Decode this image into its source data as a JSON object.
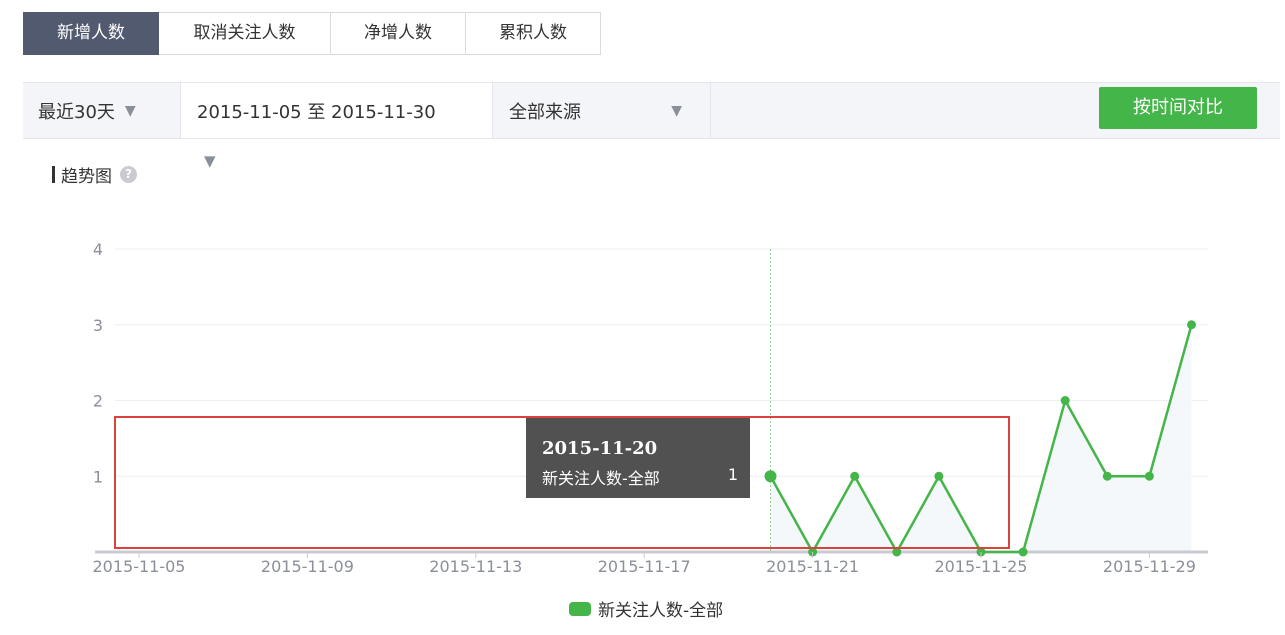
{
  "tabs": [
    {
      "label": "新增人数",
      "active": true
    },
    {
      "label": "取消关注人数",
      "active": false
    },
    {
      "label": "净增人数",
      "active": false
    },
    {
      "label": "累积人数",
      "active": false
    }
  ],
  "filters": {
    "range": "最近30天",
    "dates": "2015-11-05 至 2015-11-30",
    "source": "全部来源",
    "compare_button": "按时间对比"
  },
  "trend": {
    "title": "趋势图",
    "help_icon": "?"
  },
  "tooltip": {
    "date": "2015-11-20",
    "series": "新关注人数-全部",
    "value": "1"
  },
  "colors": {
    "accent": "#44b549",
    "active_tab": "#515a6e",
    "highlight_box": "#d9433c"
  },
  "chart_data": {
    "type": "line",
    "x": [
      "2015-11-20",
      "2015-11-21",
      "2015-11-22",
      "2015-11-23",
      "2015-11-24",
      "2015-11-25",
      "2015-11-26",
      "2015-11-27",
      "2015-11-28",
      "2015-11-29",
      "2015-11-30"
    ],
    "series": [
      {
        "name": "新关注人数-全部",
        "values": [
          1,
          0,
          1,
          0,
          1,
          0,
          0,
          2,
          1,
          1,
          3
        ],
        "color": "#44b549"
      }
    ],
    "x_tick_labels": [
      "2015-11-05",
      "2015-11-09",
      "2015-11-13",
      "2015-11-17",
      "2015-11-21",
      "2015-11-25",
      "2015-11-29"
    ],
    "x_range": [
      "2015-11-05",
      "2015-11-30"
    ],
    "y_ticks": [
      "1",
      "2",
      "3",
      "4"
    ],
    "ylim": [
      0,
      4
    ],
    "highlight_x": "2015-11-20",
    "grid": true,
    "legend_position": "bottom"
  }
}
